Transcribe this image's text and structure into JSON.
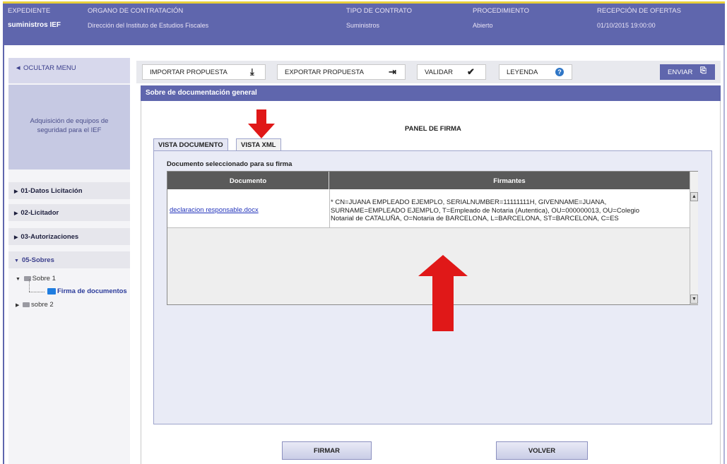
{
  "header": {
    "cols": [
      {
        "label": "EXPEDIENTE",
        "value": "suministros IEF"
      },
      {
        "label": "ORGANO DE CONTRATACIÓN",
        "value": "Dirección del Instituto de Estudios Fiscales"
      },
      {
        "label": "TIPO DE CONTRATO",
        "value": "Suministros"
      },
      {
        "label": "PROCEDIMIENTO",
        "value": "Abierto"
      },
      {
        "label": "RECEPCIÓN DE OFERTAS",
        "value": "01/10/2015 19:00:00"
      }
    ]
  },
  "sidebar": {
    "hide_menu": "◄ OCULTAR MENU",
    "project": "Adquisición de equipos de seguridad para el IEF",
    "items": [
      {
        "label": "01-Datos Licitación"
      },
      {
        "label": "02-Licitador"
      },
      {
        "label": "03-Autorizaciones"
      },
      {
        "label": "05-Sobres"
      }
    ],
    "tree": {
      "sobre1": "Sobre 1",
      "firma": "Firma de documentos",
      "sobre2": "sobre 2"
    }
  },
  "toolbar": {
    "importar": "IMPORTAR PROPUESTA",
    "exportar": "EXPORTAR PROPUESTA",
    "validar": "VALIDAR",
    "leyenda": "LEYENDA",
    "enviar": "ENVIAR"
  },
  "panel": {
    "bar_title": "Sobre de documentación general",
    "title": "PANEL DE FIRMA",
    "tabs": [
      "VISTA DOCUMENTO",
      "VISTA XML"
    ],
    "selected_label": "Documento seleccionado para su firma",
    "columns": [
      "Documento",
      "Firmantes"
    ],
    "rows": [
      {
        "documento": "declaracion responsable.docx",
        "firmantes": [
          "* CN=JUANA EMPLEADO EJEMPLO, SERIALNUMBER=11111111H, GIVENNAME=JUANA,",
          "SURNAME=EMPLEADO EJEMPLO, T=Empleado de Notaria (Autentica), OU=000000013, OU=Colegio",
          "Notarial de CATALUÑA, O=Notaria de BARCELONA, L=BARCELONA, ST=BARCELONA, C=ES"
        ]
      }
    ],
    "buttons": {
      "firmar": "FIRMAR",
      "volver": "VOLVER"
    }
  },
  "colors": {
    "brand": "#5f66ad",
    "header_accent": "#e8cf3a",
    "annotation": "#e01818"
  }
}
